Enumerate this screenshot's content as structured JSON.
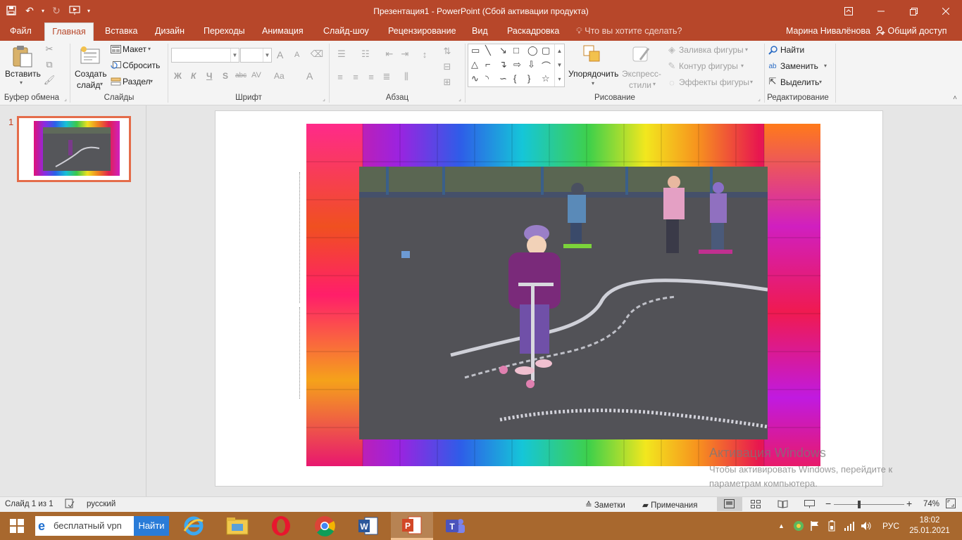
{
  "window": {
    "title": "Презентация1 - PowerPoint (Сбой активации продукта)"
  },
  "ribbon_tabs": [
    "Файл",
    "Главная",
    "Вставка",
    "Дизайн",
    "Переходы",
    "Анимация",
    "Слайд-шоу",
    "Рецензирование",
    "Вид",
    "Раскадровка"
  ],
  "tell_me": "Что вы хотите сделать?",
  "user_name": "Марина Нивалёнова",
  "share_label": "Общий доступ",
  "clipboard": {
    "paste_label": "Вставить",
    "group_label": "Буфер обмена"
  },
  "slides_group": {
    "new_slide_line1": "Создать",
    "new_slide_line2": "слайд",
    "layout": "Макет",
    "reset": "Сбросить",
    "section": "Раздел",
    "group_label": "Слайды"
  },
  "font_group": {
    "group_label": "Шрифт",
    "bold": "Ж",
    "italic": "К",
    "underline": "Ч",
    "shadow": "S",
    "strike": "abc",
    "grow": "A",
    "shrink": "A",
    "spacing": "AV",
    "case": "Aa",
    "color": "A"
  },
  "paragraph_group": {
    "group_label": "Абзац"
  },
  "drawing_group": {
    "arrange": "Упорядочить",
    "styles_line1": "Экспресс-",
    "styles_line2": "стили",
    "fill": "Заливка фигуры",
    "outline": "Контур фигуры",
    "effects": "Эффекты фигуры",
    "group_label": "Рисование"
  },
  "editing_group": {
    "find": "Найти",
    "replace": "Заменить",
    "select": "Выделить",
    "group_label": "Редактирование"
  },
  "slide_panel": {
    "slide_number": "1"
  },
  "watermark": {
    "line1": "Активация Windows",
    "line2": "Чтобы активировать Windows, перейдите к параметрам компьютера."
  },
  "statusbar": {
    "slide_info": "Слайд 1 из 1",
    "language": "русский",
    "notes": "Заметки",
    "comments": "Примечания",
    "zoom_minus": "−",
    "zoom_plus": "+",
    "zoom": "74%"
  },
  "taskbar": {
    "search_text": "бесплатный vpn",
    "search_button": "Найти",
    "lang": "РУС",
    "time": "18:02",
    "date": "25.01.2021"
  },
  "colors": {
    "accent": "#b7472a",
    "taskbar": "#a8682e"
  }
}
